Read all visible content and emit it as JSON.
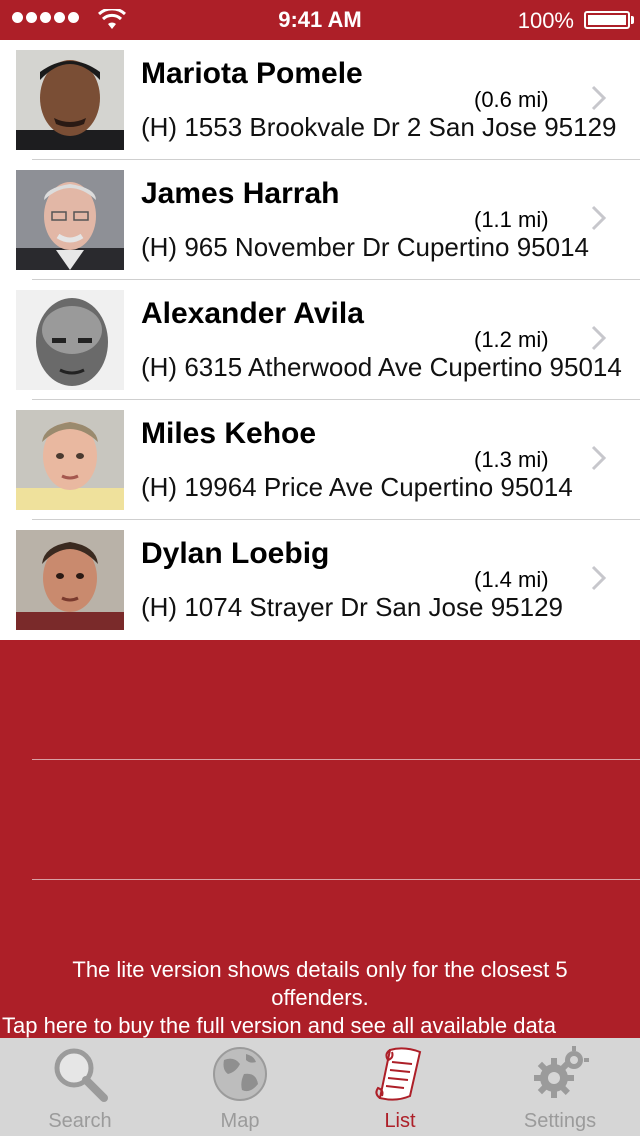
{
  "status_bar": {
    "time": "9:41 AM",
    "battery": "100%"
  },
  "offenders": [
    {
      "name": "Mariota Pomele",
      "distance": "(0.6 mi)",
      "address": "(H) 1553 Brookvale Dr 2 San Jose 95129"
    },
    {
      "name": "James Harrah",
      "distance": "(1.1 mi)",
      "address": "(H) 965 November Dr Cupertino 95014"
    },
    {
      "name": "Alexander Avila",
      "distance": "(1.2 mi)",
      "address": "(H) 6315 Atherwood Ave Cupertino 95014"
    },
    {
      "name": "Miles Kehoe",
      "distance": "(1.3 mi)",
      "address": "(H) 19964 Price Ave Cupertino 95014"
    },
    {
      "name": "Dylan Loebig",
      "distance": "(1.4 mi)",
      "address": "(H) 1074 Strayer Dr San Jose 95129"
    }
  ],
  "notice": {
    "line1": "The lite version shows details only for the closest 5",
    "line2": "offenders.",
    "line3": "Tap here to buy the full version and see all available data"
  },
  "tabs": [
    {
      "label": "Search",
      "icon": "magnifier-icon"
    },
    {
      "label": "Map",
      "icon": "globe-icon"
    },
    {
      "label": "List",
      "icon": "scroll-icon",
      "active": true
    },
    {
      "label": "Settings",
      "icon": "gears-icon"
    }
  ],
  "colors": {
    "accent": "#ad1f28",
    "tab_bar": "#d6d6d6",
    "inactive": "#9b9b9b"
  }
}
